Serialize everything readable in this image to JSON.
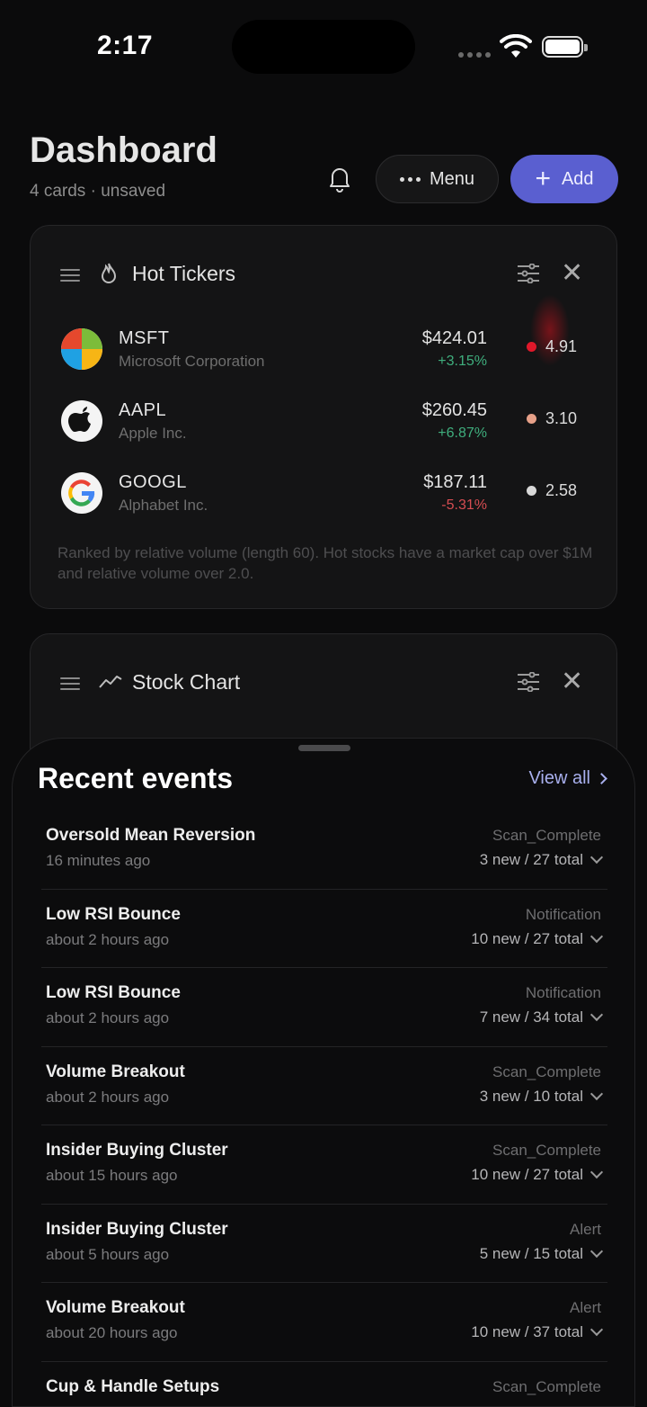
{
  "status_bar": {
    "time": "2:17"
  },
  "header": {
    "title": "Dashboard",
    "subtitle": "4 cards · unsaved",
    "menu_label": "Menu",
    "add_label": "Add",
    "add_color": "#5a5fd0"
  },
  "hot_tickers": {
    "title": "Hot Tickers",
    "tickers": [
      {
        "symbol": "MSFT",
        "name": "Microsoft Corporation",
        "price": "$424.01",
        "change": "+3.15%",
        "rel_volume": "4.91",
        "dot_color": "#e0182a"
      },
      {
        "symbol": "AAPL",
        "name": "Apple Inc.",
        "price": "$260.45",
        "change": "+6.87%",
        "rel_volume": "3.10",
        "dot_color": "#e6a088"
      },
      {
        "symbol": "GOOGL",
        "name": "Alphabet Inc.",
        "price": "$187.11",
        "change": "-5.31%",
        "rel_volume": "2.58",
        "dot_color": "#d8d8d8"
      }
    ],
    "note": "Ranked by relative volume (length 60). Hot stocks have a market cap over $1M and relative volume over 2.0."
  },
  "stock_chart": {
    "title": "Stock Chart"
  },
  "recent_events": {
    "title": "Recent events",
    "view_all": "View all",
    "events": [
      {
        "name": "Oversold Mean Reversion",
        "time": "16 minutes ago",
        "type": "Scan_Complete",
        "count": "3 new / 27 total"
      },
      {
        "name": "Low RSI Bounce",
        "time": "about 2 hours ago",
        "type": "Notification",
        "count": "10 new / 27 total"
      },
      {
        "name": "Low RSI Bounce",
        "time": "about 2 hours ago",
        "type": "Notification",
        "count": "7 new / 34 total"
      },
      {
        "name": "Volume Breakout",
        "time": "about 2 hours ago",
        "type": "Scan_Complete",
        "count": "3 new / 10 total"
      },
      {
        "name": "Insider Buying Cluster",
        "time": "about 15 hours ago",
        "type": "Scan_Complete",
        "count": "10 new / 27 total"
      },
      {
        "name": "Insider Buying Cluster",
        "time": "about 5 hours ago",
        "type": "Alert",
        "count": "5 new / 15 total"
      },
      {
        "name": "Volume Breakout",
        "time": "about 20 hours ago",
        "type": "Alert",
        "count": "10 new / 37 total"
      },
      {
        "name": "Cup & Handle Setups",
        "time": "",
        "type": "Scan_Complete",
        "count": ""
      }
    ]
  }
}
